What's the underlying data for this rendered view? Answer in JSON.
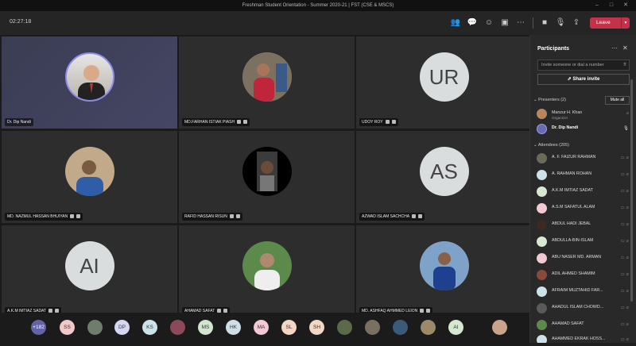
{
  "window": {
    "title": "Freshman Student Orientation - Summer 2020-21 | FST (CSE & MSCS)"
  },
  "toolbar": {
    "timer": "02:27:18",
    "leave_label": "Leave"
  },
  "tiles": [
    {
      "name": "Dr. Dip Nandi",
      "initials": ""
    },
    {
      "name": "MD.FARHAN ISTIAK PIASH",
      "initials": ""
    },
    {
      "name": "UDOY ROY",
      "initials": "UR"
    },
    {
      "name": "MD. NAZMUL HASSAN BHUIYAN",
      "initials": ""
    },
    {
      "name": "RAFID HASSAN RISUN",
      "initials": ""
    },
    {
      "name": "AZWAD ISLAM SACHCHA",
      "initials": "AS"
    },
    {
      "name": "A.K.M IMTIAZ SADAT",
      "initials": "AI"
    },
    {
      "name": "AHAMAD SAFAT",
      "initials": ""
    },
    {
      "name": "MD. ASHFAQ AHMMED LEION",
      "initials": ""
    }
  ],
  "strip": {
    "count": "+182",
    "chips": [
      "SS",
      "",
      "DP",
      "KS",
      "",
      "MS",
      "HK",
      "MA",
      "SL",
      "SH",
      "",
      "",
      "",
      "",
      "AI",
      ""
    ]
  },
  "panel": {
    "title": "Participants",
    "invite_placeholder": "Invite someone or dial a number",
    "share_label": "Share invite",
    "presenters_label": "Presenters (2)",
    "mute_all": "Mute all",
    "presenters": [
      {
        "name": "Manzur H. Khan",
        "role": "Organizer"
      },
      {
        "name": "Dr. Dip Nandi",
        "role": ""
      }
    ],
    "attendees_label": "Attendees (205)",
    "attendees": [
      "A. F. FAIZUR RAHMAN",
      "A. RAHMAN ROHAN",
      "A.K.M IMTIAZ SADAT",
      "A.S.M SAFATUL ALAM",
      "ABDUL HADI JEBAL",
      "ABDULLA-BIN-ISLAM",
      "ABU NASER MD. ARMAN",
      "ADIL AHMED SHAMIM",
      "AFRAIM MUZTAHID FAR...",
      "AHADUL ISLAM CHOWD...",
      "AHAMAD SAFAT",
      "AHAMMED EKRAK HOSS..."
    ]
  },
  "colors": {
    "accent": "#6264a7",
    "leave": "#c4314b",
    "panel_bg": "#292929"
  },
  "icons": [
    "people-icon",
    "chat-icon",
    "reactions-icon",
    "rooms-icon",
    "more-icon",
    "camera-icon",
    "mic-icon",
    "share-icon"
  ]
}
